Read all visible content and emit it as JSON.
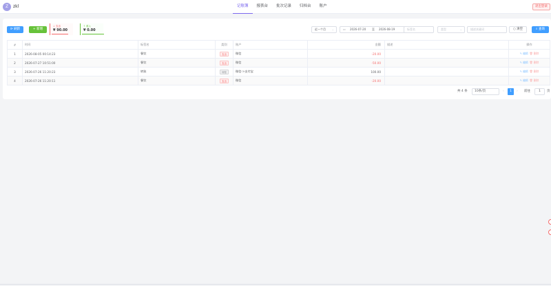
{
  "user": {
    "avatar_letter": "Z",
    "name": "zkl"
  },
  "nav": [
    "记账簿",
    "报表台",
    "批次记录",
    "归档台",
    "账户"
  ],
  "nav_active": 0,
  "logout_label": "退出登录",
  "toolbar": {
    "refresh_label": "刷新",
    "add_label": "新增",
    "expense_label": "支出",
    "expense_value": "¥ 90.00",
    "income_label": "收入",
    "income_value": "¥ 0.00"
  },
  "filters": {
    "period": "近一个月",
    "date_start": "2026-07-20",
    "date_sep": "至",
    "date_end": "2026-08-19",
    "title_placeholder": "标签名",
    "type_placeholder": "类型",
    "desc_placeholder": "描述关键词",
    "clear_label": "清空",
    "search_label": "查询"
  },
  "table": {
    "headers": [
      "#",
      "时间",
      "标签名",
      "类别",
      "账户",
      "金额",
      "描述",
      "操作"
    ],
    "rows": [
      {
        "idx": "1",
        "time": "2026-08-05 00:14:23",
        "tag": "餐饮",
        "type": "支出",
        "account": "微信",
        "amount": "-20.00",
        "desc": ""
      },
      {
        "idx": "2",
        "time": "2026-07-27 10:51:00",
        "tag": "餐饮",
        "type": "支出",
        "account": "微信",
        "amount": "-50.00",
        "desc": ""
      },
      {
        "idx": "3",
        "time": "2026-07-26 11:20:23",
        "tag": "转账",
        "type": "转账",
        "account": "微信->支付宝",
        "amount": "100.00",
        "desc": ""
      },
      {
        "idx": "4",
        "time": "2026-07-26 11:20:11",
        "tag": "餐饮",
        "type": "支出",
        "account": "微信",
        "amount": "-20.00",
        "desc": ""
      }
    ],
    "edit_label": "编辑",
    "delete_label": "删除"
  },
  "pagination": {
    "total": "共 4 条",
    "page_size": "10条/页",
    "current": "1",
    "goto_label": "前往",
    "goto_value": "1",
    "unit": "页"
  },
  "colors": {
    "primary": "#409eff",
    "success": "#67c23a",
    "danger": "#f56c6c",
    "accent": "#7b68ee"
  }
}
